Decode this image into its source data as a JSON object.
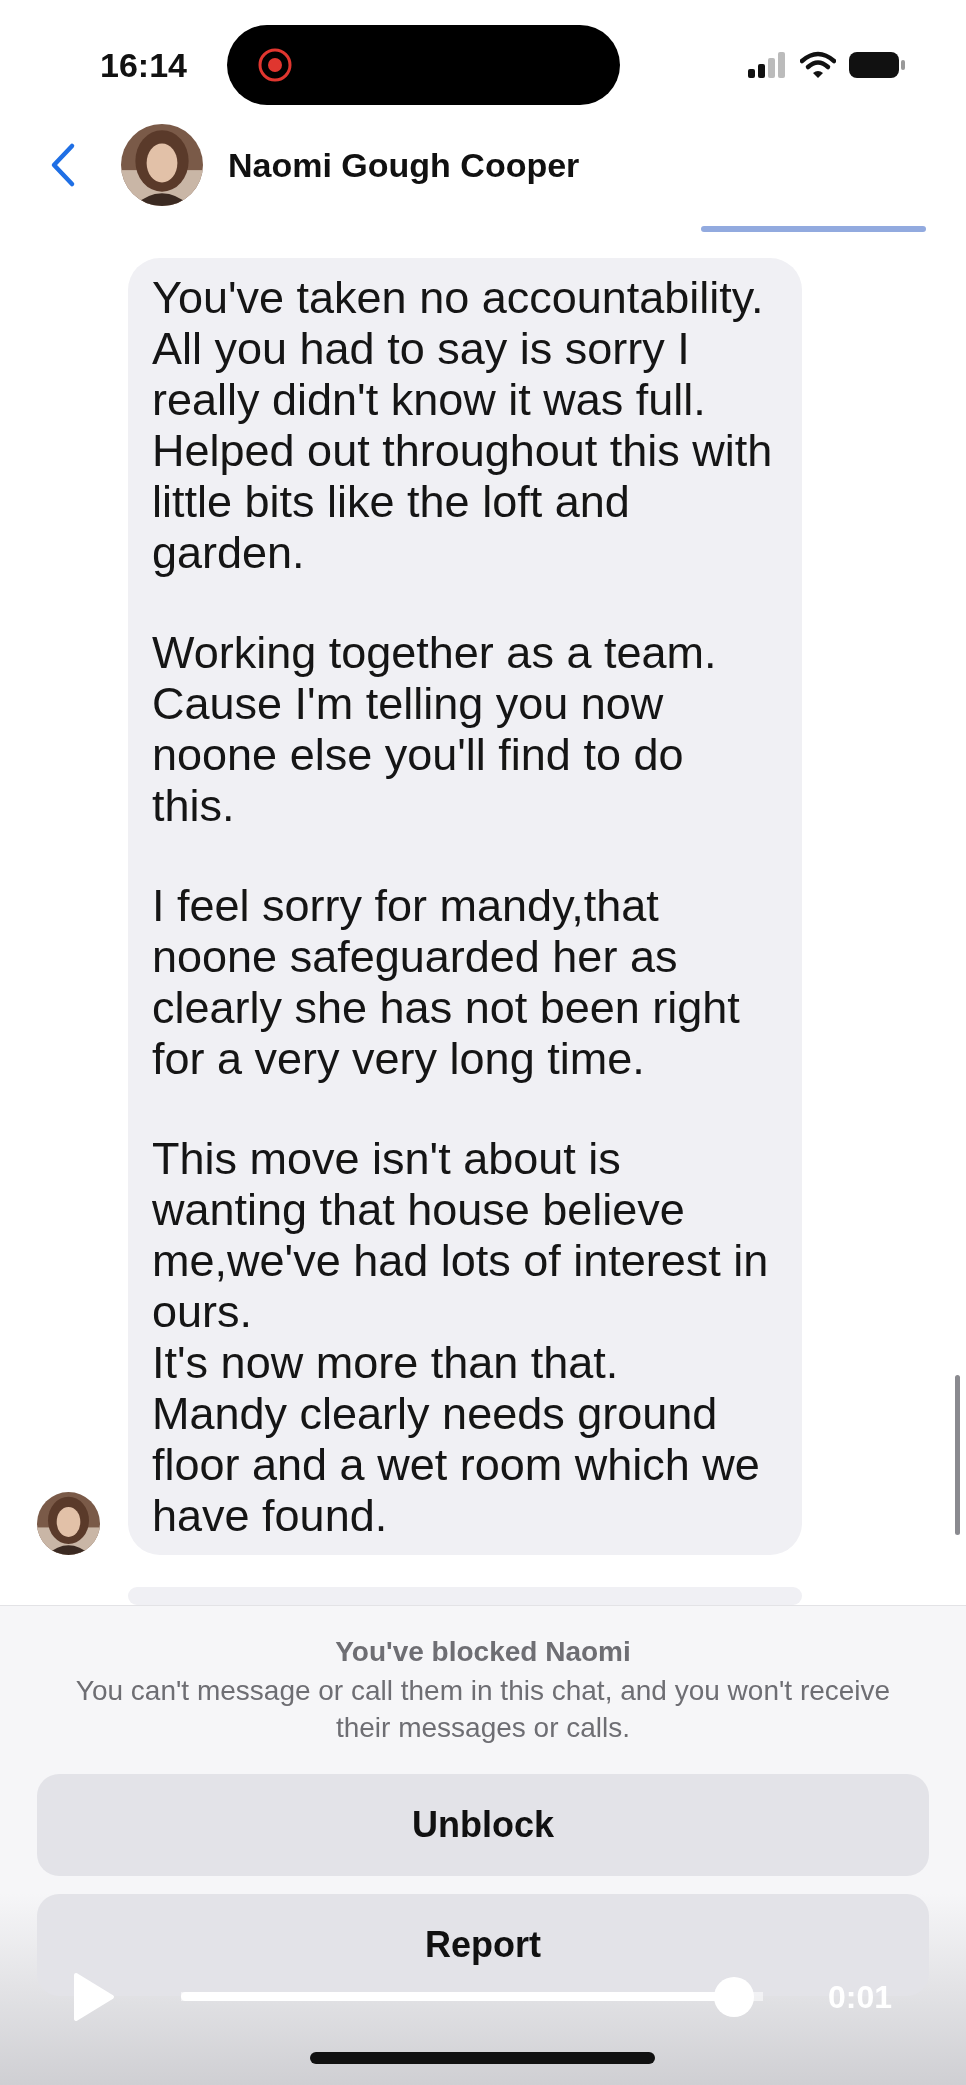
{
  "status_bar": {
    "time": "16:14"
  },
  "header": {
    "title": "Naomi Gough Cooper"
  },
  "message": {
    "paragraphs": [
      [
        "You've taken no accountability. All you had to say is sorry I really didn't know it was full. Helped out throughout this with little bits like the loft and garden."
      ],
      [
        "Working together as a team. Cause I'm telling you now noone else you'll find to do this."
      ],
      [
        "I feel sorry for mandy,that noone safeguarded her as clearly she has not been right for a very very long time."
      ],
      [
        "This move isn't about is wanting that house believe me,we've had lots of interest in ours.",
        "It's now more than that.",
        "Mandy clearly needs ground floor and a wet room which we have found."
      ]
    ]
  },
  "blocked_notice": {
    "title": "You've blocked Naomi",
    "text": "You can't message or call them in this chat, and you won't receive their messages or calls."
  },
  "buttons": [
    "Unblock",
    "Report"
  ],
  "video_player": {
    "level": 0.95,
    "time": "0:01"
  }
}
